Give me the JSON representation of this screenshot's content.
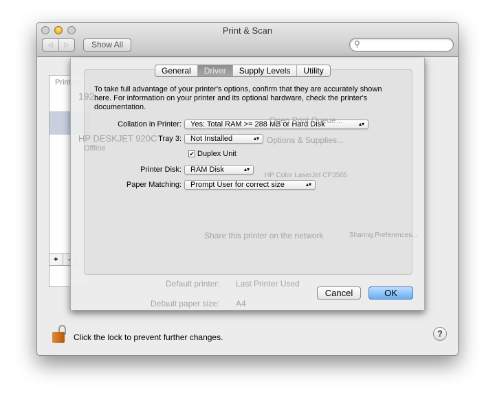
{
  "window": {
    "title": "Print & Scan",
    "show_all": "Show All",
    "back_icon": "◁",
    "forward_icon": "▷",
    "search_placeholder": ""
  },
  "background": {
    "printers_header": "Printers",
    "printer_1": "192...",
    "printer_3": "HP DESKJET 920C",
    "printer_3_status": "Offline",
    "open_queue": "Open Print Queue...",
    "options_supplies": "Options & Supplies...",
    "kind": "HP Color LaserJet CP3505",
    "share": "Share this printer on the network",
    "sharing_prefs": "Sharing Preferences...",
    "default_printer_label": "Default printer:",
    "default_printer": "Last Printer Used",
    "default_paper_label": "Default paper size:",
    "default_paper": "A4"
  },
  "footer": {
    "lock_text": "Click the lock to prevent further changes.",
    "help": "?",
    "add": "+",
    "remove": "-"
  },
  "sheet": {
    "tabs": [
      {
        "label": "General",
        "selected": false
      },
      {
        "label": "Driver",
        "selected": true
      },
      {
        "label": "Supply Levels",
        "selected": false
      },
      {
        "label": "Utility",
        "selected": false
      }
    ],
    "description": "To take full advantage of your printer's options, confirm that they are accurately shown here. For information on your printer and its optional hardware, check the printer's documentation.",
    "options": {
      "collation_label": "Collation in Printer:",
      "collation_value": "Yes: Total RAM >= 288 MB or Hard Disk",
      "tray3_label": "Tray 3:",
      "tray3_value": "Not Installed",
      "duplex_label": "Duplex Unit",
      "duplex_checked": true,
      "disk_label": "Printer Disk:",
      "disk_value": "RAM Disk",
      "paper_label": "Paper Matching:",
      "paper_value": "Prompt User for correct size"
    },
    "cancel": "Cancel",
    "ok": "OK"
  }
}
